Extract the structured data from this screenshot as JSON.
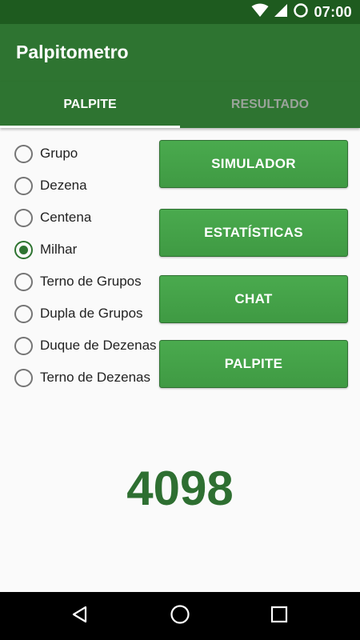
{
  "status_bar": {
    "time": "07:00",
    "icons": [
      "wifi-icon",
      "signal-icon",
      "battery-icon"
    ]
  },
  "app_bar": {
    "title": "Palpitometro"
  },
  "tabs": [
    {
      "label": "PALPITE",
      "active": true
    },
    {
      "label": "RESULTADO",
      "active": false
    }
  ],
  "bet_types": {
    "selected": "Milhar",
    "options": [
      {
        "label": "Grupo",
        "checked": false
      },
      {
        "label": "Dezena",
        "checked": false
      },
      {
        "label": "Centena",
        "checked": false
      },
      {
        "label": "Milhar",
        "checked": true
      },
      {
        "label": "Terno de Grupos",
        "checked": false
      },
      {
        "label": "Dupla de Grupos",
        "checked": false
      },
      {
        "label": "Duque de Dezenas",
        "checked": false
      },
      {
        "label": "Terno de Dezenas",
        "checked": false
      }
    ]
  },
  "actions": {
    "simulador": "SIMULADOR",
    "estatisticas": "ESTATÍSTICAS",
    "chat": "CHAT",
    "palpite": "PALPITE"
  },
  "result": {
    "value": "4098"
  },
  "nav_bar": {
    "icons": [
      "back-icon",
      "home-icon",
      "recents-icon"
    ]
  },
  "colors": {
    "status_bar": "#1e5b1f",
    "primary": "#2e7431",
    "button": "#45a249",
    "result_text": "#2e6f31"
  }
}
